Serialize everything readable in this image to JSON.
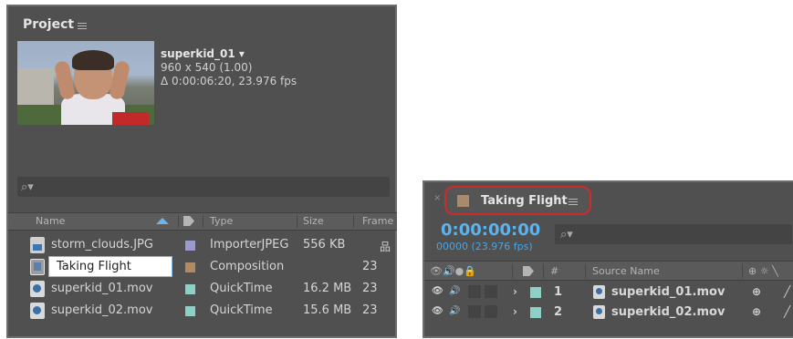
{
  "project": {
    "title": "Project",
    "selected": {
      "name": "superkid_01 ▾",
      "resolution": "960 x 540 (1.00)",
      "duration": "Δ 0:00:06:20, 23.976 fps"
    },
    "search_glyph": "⌕▾",
    "columns": {
      "name": "Name",
      "type": "Type",
      "size": "Size",
      "frame": "Frame"
    },
    "rows": [
      {
        "name": "storm_clouds.JPG",
        "type": "ImporterJPEG",
        "size": "556 KB",
        "frame": "",
        "swatch": "#9a9ad0",
        "icon": "jpg-file-icon"
      },
      {
        "name": "Taking Flight",
        "type": "Composition",
        "size": "",
        "frame": "23",
        "swatch": "#b08a64",
        "icon": "composition-icon"
      },
      {
        "name": "superkid_01.mov",
        "type": "QuickTime",
        "size": "16.2 MB",
        "frame": "23",
        "swatch": "#8ed0c6",
        "icon": "quicktime-file-icon"
      },
      {
        "name": "superkid_02.mov",
        "type": "QuickTime",
        "size": "15.6 MB",
        "frame": "23",
        "swatch": "#8ed0c6",
        "icon": "quicktime-file-icon"
      }
    ]
  },
  "timeline": {
    "tab_label": "Taking Flight",
    "close_glyph": "×",
    "timecode": "0:00:00:00",
    "frames": "00000 (23.976 fps)",
    "search_glyph": "⌕▾",
    "columns": {
      "num": "#",
      "source_name": "Source Name"
    },
    "layers": [
      {
        "num": "1",
        "name": "superkid_01.mov"
      },
      {
        "num": "2",
        "name": "superkid_02.mov"
      }
    ]
  },
  "colors": {
    "timecode": "#5bb4f0",
    "highlight": "#cf2b2b",
    "sort_arrow": "#6fb4e8"
  }
}
